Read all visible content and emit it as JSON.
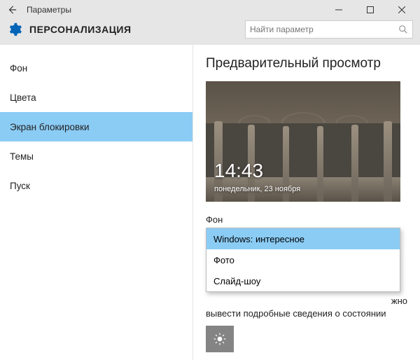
{
  "titlebar": {
    "title": "Параметры"
  },
  "header": {
    "section": "ПЕРСОНАЛИЗАЦИЯ",
    "search_placeholder": "Найти параметр"
  },
  "sidebar": {
    "items": [
      {
        "label": "Фон",
        "selected": false
      },
      {
        "label": "Цвета",
        "selected": false
      },
      {
        "label": "Экран блокировки",
        "selected": true
      },
      {
        "label": "Темы",
        "selected": false
      },
      {
        "label": "Пуск",
        "selected": false
      }
    ]
  },
  "main": {
    "preview_title": "Предварительный просмотр",
    "preview": {
      "time": "14:43",
      "date": "понедельник, 23 ноября"
    },
    "background_label": "Фон",
    "background_options": [
      {
        "label": "Windows: интересное",
        "selected": true
      },
      {
        "label": "Фото",
        "selected": false
      },
      {
        "label": "Слайд-шоу",
        "selected": false
      }
    ],
    "detail_text_tail": "жно",
    "detail_text_line2": "вывести подробные сведения о состоянии"
  }
}
